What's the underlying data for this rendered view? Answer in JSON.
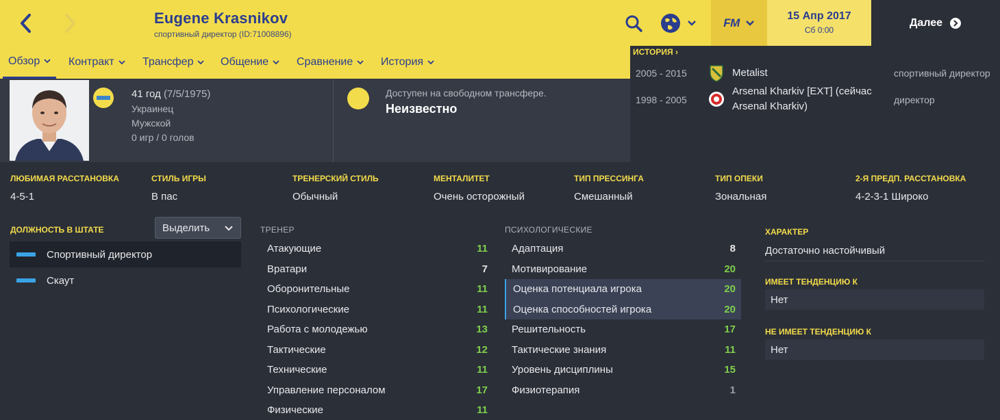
{
  "header": {
    "name": "Eugene Krasnikov",
    "role": "спортивный директор (ID:71008896)",
    "date": "15 Апр 2017",
    "time": "Сб 0:00",
    "continue_label": "Далее",
    "fm_logo": "FM"
  },
  "tabs": [
    {
      "label": "Обзор"
    },
    {
      "label": "Контракт"
    },
    {
      "label": "Трансфер"
    },
    {
      "label": "Общение"
    },
    {
      "label": "Сравнение"
    },
    {
      "label": "История"
    }
  ],
  "history": {
    "title": "ИСТОРИЯ ›",
    "rows": [
      {
        "years": "2005 - 2015",
        "club": "Metalist",
        "role": "спортивный директор"
      },
      {
        "years": "1998 - 2005",
        "club": "Arsenal Kharkiv [EXT] (сейчас Arsenal Kharkiv)",
        "role": "директор"
      }
    ]
  },
  "profile": {
    "age": "41 год",
    "dob": "(7/5/1975)",
    "nationality": "Украинец",
    "gender": "Мужской",
    "stats": "0 игр / 0 голов",
    "transfer_status": "Доступен на свободном трансфере.",
    "transfer_value": "Неизвестно"
  },
  "tactics": [
    {
      "label": "ЛЮБИМАЯ РАССТАНОВКА",
      "value": "4-5-1"
    },
    {
      "label": "СТИЛЬ ИГРЫ",
      "value": "В пас"
    },
    {
      "label": "ТРЕНЕРСКИЙ СТИЛЬ",
      "value": "Обычный"
    },
    {
      "label": "МЕНТАЛИТЕТ",
      "value": "Очень осторожный"
    },
    {
      "label": "ТИП ПРЕССИНГА",
      "value": "Смешанный"
    },
    {
      "label": "ТИП ОПЕКИ",
      "value": "Зональная"
    },
    {
      "label": "2-Я ПРЕДП. РАССТАНОВКА",
      "value": "4-2-3-1 Широко"
    }
  ],
  "positions": {
    "title": "ДОЛЖНОСТЬ В ШТАТЕ",
    "select_label": "Выделить",
    "items": [
      {
        "label": "Спортивный директор"
      },
      {
        "label": "Скаут"
      }
    ]
  },
  "coach": {
    "title": "ТРЕНЕР",
    "items": [
      {
        "label": "Атакующие",
        "value": "11"
      },
      {
        "label": "Вратари",
        "value": "7"
      },
      {
        "label": "Оборонительные",
        "value": "11"
      },
      {
        "label": "Психологические",
        "value": "11"
      },
      {
        "label": "Работа с молодежью",
        "value": "13"
      },
      {
        "label": "Тактические",
        "value": "12"
      },
      {
        "label": "Технические",
        "value": "11"
      },
      {
        "label": "Управление персоналом",
        "value": "17"
      },
      {
        "label": "Физические",
        "value": "11"
      }
    ]
  },
  "mental": {
    "title": "ПСИХОЛОГИЧЕСКИЕ",
    "items": [
      {
        "label": "Адаптация",
        "value": "8"
      },
      {
        "label": "Мотивирование",
        "value": "20"
      },
      {
        "label": "Оценка потенциала игрока",
        "value": "20"
      },
      {
        "label": "Оценка способностей игрока",
        "value": "20"
      },
      {
        "label": "Решительность",
        "value": "17"
      },
      {
        "label": "Тактические знания",
        "value": "11"
      },
      {
        "label": "Уровень дисциплины",
        "value": "15"
      },
      {
        "label": "Физиотерапия",
        "value": "1"
      }
    ]
  },
  "character": {
    "title": "ХАРАКТЕР",
    "value": "Достаточно настойчивый",
    "tends_title": "ИМЕЕТ ТЕНДЕНЦИЮ К",
    "tends_value": "Нет",
    "not_tends_title": "НЕ ИМЕЕТ ТЕНДЕНЦИЮ К",
    "not_tends_value": "Нет"
  },
  "colors": {
    "accent_yellow": "#f3dc4b",
    "brand_blue": "#2a3d8f",
    "high_value": "#7fd04c",
    "position_bar": "#3aa3e6"
  }
}
